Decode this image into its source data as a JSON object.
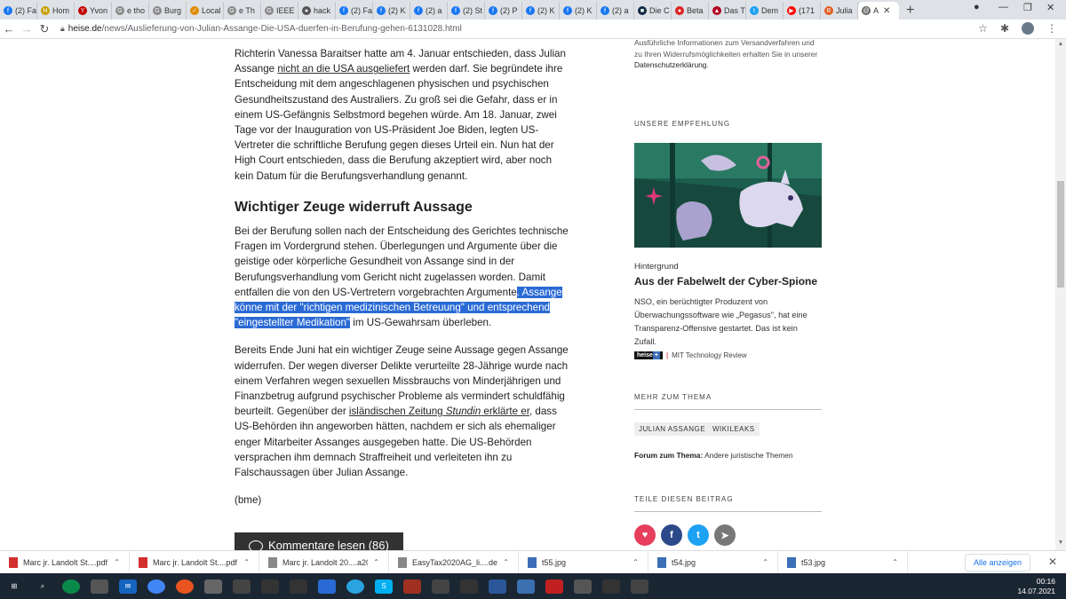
{
  "tabs": [
    {
      "label": "(2) Fa",
      "color": "#1877f2",
      "glyph": "f"
    },
    {
      "label": "Hom",
      "color": "#c8a000",
      "glyph": "H"
    },
    {
      "label": "Yvon",
      "color": "#c00000",
      "glyph": "Y"
    },
    {
      "label": "e tho",
      "color": "#888888",
      "glyph": "G"
    },
    {
      "label": "Burg",
      "color": "#888888",
      "glyph": "G"
    },
    {
      "label": "Local",
      "color": "#e08a00",
      "glyph": "✓"
    },
    {
      "label": "e Th",
      "color": "#888888",
      "glyph": "G"
    },
    {
      "label": "IEEE",
      "color": "#888888",
      "glyph": "G"
    },
    {
      "label": "hack",
      "color": "#555555",
      "glyph": "●"
    },
    {
      "label": "(2) Fa",
      "color": "#1877f2",
      "glyph": "f"
    },
    {
      "label": "(2) K",
      "color": "#1877f2",
      "glyph": "f"
    },
    {
      "label": "(2) a",
      "color": "#1877f2",
      "glyph": "f"
    },
    {
      "label": "(2) St",
      "color": "#1877f2",
      "glyph": "f"
    },
    {
      "label": "(2) P",
      "color": "#1877f2",
      "glyph": "f"
    },
    {
      "label": "(2) K",
      "color": "#1877f2",
      "glyph": "f"
    },
    {
      "label": "(2) K",
      "color": "#1877f2",
      "glyph": "f"
    },
    {
      "label": "(2) a",
      "color": "#1877f2",
      "glyph": "f"
    },
    {
      "label": "Die C",
      "color": "#102a43",
      "glyph": "■"
    },
    {
      "label": "Beta",
      "color": "#d22",
      "glyph": "●"
    },
    {
      "label": "Das T",
      "color": "#b00020",
      "glyph": "▲"
    },
    {
      "label": "Dem",
      "color": "#1da1f2",
      "glyph": "t"
    },
    {
      "label": "(171",
      "color": "#ff0000",
      "glyph": "▶"
    },
    {
      "label": "Julia",
      "color": "#e25a1c",
      "glyph": "B"
    },
    {
      "label": "A",
      "color": "#666666",
      "glyph": "@"
    }
  ],
  "address": {
    "domain": "heise.de",
    "path": "/news/Auslieferung-von-Julian-Assange-Die-USA-duerfen-in-Berufung-gehen-6131028.html"
  },
  "article": {
    "p1": {
      "a": "Richterin Vanessa Baraitser hatte am 4. Januar entschieden, dass Julian Assange ",
      "link": "nicht an die USA ausgeliefert",
      "b": " werden darf. Sie begründete ihre Entscheidung mit dem angeschlagenen physischen und psychischen Gesundheitszustand des Australiers. Zu groß sei die Gefahr, dass er in einem US-Gefängnis Selbstmord begehen würde. Am 18. Januar, zwei Tage vor der Inauguration von US-Präsident Joe Biden, legten US-Vertreter die schriftliche Berufung gegen dieses Urteil ein. Nun hat der High Court entschieden, dass die Berufung akzeptiert wird, aber noch kein Datum für die Berufungsverhandlung genannt."
    },
    "heading": "Wichtiger Zeuge widerruft Aussage",
    "p2": {
      "a": "Bei der Berufung sollen nach der Entscheidung des Gerichtes technische Fragen im Vordergrund stehen. Überlegungen und Argumente über die geistige oder körperliche Gesundheit von Assange sind in der Berufungsverhandlung vom Gericht nicht zugelassen worden. Damit entfallen die von den US-Vertretern vorgebrachten Argumente",
      "selected": ". Assange könne mit der \"richtigen medizinischen Betreuung\" und entsprechend \"eingestellter Medikation\"",
      "b": " im US-Gewahrsam überleben."
    },
    "p3": {
      "a": "Bereits Ende Juni hat ein wichtiger Zeuge seine Aussage gegen Assange widerrufen. Der wegen diverser Delikte verurteilte 28-Jährige wurde nach einem Verfahren wegen sexuellen Missbrauchs von Minderjährigen und Finanzbetrug aufgrund psychischer Probleme als vermindert schuldfähig beurteilt. Gegenüber der ",
      "link": "isländischen Zeitung ",
      "link_em": "Stundin",
      "link2": " erklärte er",
      "b": ", dass US-Behörden ihn angeworben hätten, nachdem er sich als ehemaliger enger Mitarbeiter Assanges ausgegeben hatte. Die US-Behörden versprachen ihm demnach Straffreiheit und verleiteten ihn zu Falschaussagen über Julian Assange."
    },
    "signature": "(bme)",
    "comments_button": "Kommentare lesen (86)"
  },
  "sidebar": {
    "info_a": "Ausführliche Informationen zum Versandverfahren und zu Ihren Widerrufsmöglichkeiten erhalten Sie in unserer ",
    "info_link": "Datenschutzerklärung",
    "info_b": ".",
    "recommend_heading": "UNSERE EMPFEHLUNG",
    "teaser_kicker": "Hintergrund",
    "teaser_title": "Aus der Fabelwelt der Cyber-Spione",
    "teaser_text": "NSO, ein berüchtigter Produzent von Überwachungssoftware wie „Pegasus\", hat eine Transparenz-Offensive gestartet. Das ist kein Zufall.",
    "partner_heise": "heise",
    "partner_plus": "+",
    "partner_sep": "|",
    "partner_name": "MIT Technology Review",
    "more_heading": "MEHR ZUM THEMA",
    "tag1": "JULIAN ASSANGE",
    "tag2": "WIKILEAKS",
    "forum_label": "Forum zum Thema:",
    "forum_value": " Andere juristische Themen",
    "share_heading": "TEILE DIESEN BEITRAG",
    "accent": "#e63e5c"
  },
  "downloads": [
    {
      "name": "Marc jr. Landolt St....pdf",
      "type": "pdf"
    },
    {
      "name": "Marc jr. Landolt St....pdf",
      "type": "pdf"
    },
    {
      "name": "Marc jr. Landolt 20....a20",
      "type": "file"
    },
    {
      "name": "EasyTax2020AG_li....deb",
      "type": "file"
    },
    {
      "name": "t55.jpg",
      "type": "img"
    },
    {
      "name": "t54.jpg",
      "type": "img"
    },
    {
      "name": "t53.jpg",
      "type": "img"
    }
  ],
  "downloads_show_all": "Alle anzeigen",
  "clock": {
    "time": "00:16",
    "date": "14.07.2021"
  }
}
